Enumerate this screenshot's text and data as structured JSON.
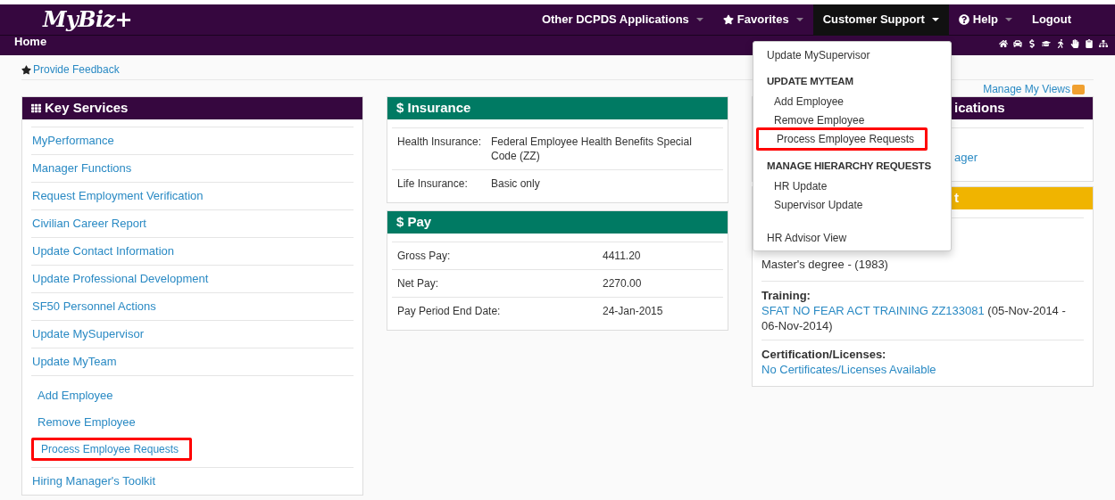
{
  "logo": "MyBiz+",
  "nav": [
    {
      "label": "Other DCPDS Applications",
      "dropdown": true,
      "selected": false
    },
    {
      "label": "Favorites",
      "dropdown": true,
      "selected": false
    },
    {
      "label": "Customer Support",
      "dropdown": true,
      "selected": true
    },
    {
      "label": "Help",
      "dropdown": true,
      "selected": false
    },
    {
      "label": "Logout",
      "dropdown": false,
      "selected": false
    }
  ],
  "breadcrumb": "Home",
  "feedback_link": "Provide Feedback",
  "manage_views": "Manage My Views",
  "key_services": {
    "title": "Key Services",
    "items": [
      {
        "label": "MyPerformance",
        "highlighted": false
      },
      {
        "label": "Manager Functions",
        "highlighted": false
      },
      {
        "label": "Request Employment Verification",
        "highlighted": false
      },
      {
        "label": "Civilian Career Report",
        "highlighted": false
      },
      {
        "label": "Update Contact Information",
        "highlighted": false
      },
      {
        "label": "Update Professional Development",
        "highlighted": false
      },
      {
        "label": "SF50 Personnel Actions",
        "highlighted": false
      },
      {
        "label": "Update MySupervisor",
        "highlighted": false
      },
      {
        "label": "Update MyTeam",
        "highlighted": false,
        "children": [
          {
            "label": "Add Employee",
            "highlighted": false
          },
          {
            "label": "Remove Employee",
            "highlighted": false
          },
          {
            "label": "Process Employee Requests",
            "highlighted": true
          }
        ]
      },
      {
        "label": "Hiring Manager's Toolkit",
        "highlighted": false
      }
    ]
  },
  "insurance": {
    "title": "$ Insurance",
    "rows": [
      {
        "label": "Health Insurance:",
        "value": "Federal Employee Health Benefits Special Code (ZZ)"
      },
      {
        "label": "Life Insurance:",
        "value": "Basic only"
      }
    ]
  },
  "pay": {
    "title": "$ Pay",
    "rows": [
      {
        "label": "Gross Pay:",
        "value": "4411.20"
      },
      {
        "label": "Net Pay:",
        "value": "2270.00"
      },
      {
        "label": "Pay Period End Date:",
        "value": "24-Jan-2015"
      }
    ]
  },
  "applications_panel": {
    "title": "ications",
    "link": "ager"
  },
  "education_panel": {
    "title": "t",
    "degree": "Master's degree - (1983)",
    "training_label": "Training:",
    "training_link": "SFAT NO FEAR ACT TRAINING ZZ133081",
    "training_dates": "(05-Nov-2014 - 06-Nov-2014)",
    "cert_label": "Certification/Licenses:",
    "cert_link": "No Certificates/Licenses Available"
  },
  "support_menu": [
    {
      "kind": "item",
      "label": "Update MySupervisor",
      "highlighted": false
    },
    {
      "kind": "header",
      "label": "UPDATE MYTEAM"
    },
    {
      "kind": "subitem",
      "label": "Add Employee",
      "highlighted": false
    },
    {
      "kind": "subitem",
      "label": "Remove Employee",
      "highlighted": false
    },
    {
      "kind": "subitem",
      "label": "Process Employee Requests",
      "highlighted": true
    },
    {
      "kind": "header",
      "label": "MANAGE HIERARCHY REQUESTS"
    },
    {
      "kind": "subitem",
      "label": "HR Update",
      "highlighted": false
    },
    {
      "kind": "subitem",
      "label": "Supervisor Update",
      "highlighted": false
    },
    {
      "kind": "spacer"
    },
    {
      "kind": "item",
      "label": "HR Advisor View",
      "highlighted": false
    }
  ]
}
